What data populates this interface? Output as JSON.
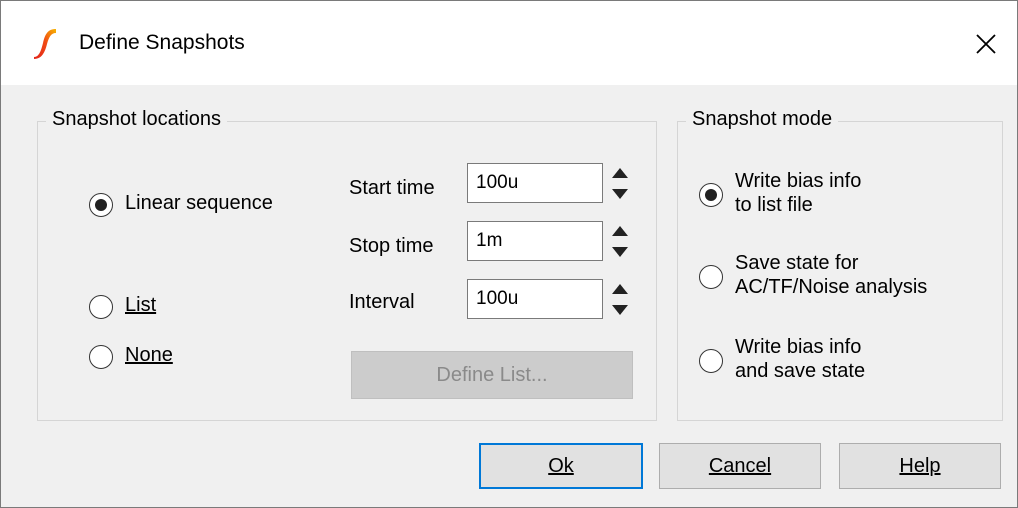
{
  "window": {
    "title": "Define Snapshots",
    "close_label": "✕"
  },
  "locations": {
    "group_label": "Snapshot locations",
    "radios": [
      {
        "label": "Linear sequence",
        "checked": true
      },
      {
        "label": "List",
        "checked": false
      },
      {
        "label": "None",
        "checked": false
      }
    ],
    "fields": [
      {
        "label": "Start time",
        "value": "100u"
      },
      {
        "label": "Stop time",
        "value": "1m"
      },
      {
        "label": "Interval",
        "value": "100u"
      }
    ],
    "define_list_label": "Define List..."
  },
  "mode": {
    "group_label": "Snapshot mode",
    "options": [
      {
        "line1": "Write bias info",
        "line2": "to list file",
        "checked": true
      },
      {
        "line1": "Save state for",
        "line2": "AC/TF/Noise analysis",
        "checked": false
      },
      {
        "line1": "Write bias info",
        "line2": "and save state",
        "checked": false
      }
    ]
  },
  "footer": {
    "ok_label": "Ok",
    "cancel_label": "Cancel",
    "help_label": "Help"
  },
  "colors": {
    "default_button_border": "#0078d7",
    "dialog_background": "#f0f0f0",
    "app_icon_red": "#e2231a",
    "app_icon_yellow": "#f7b500"
  }
}
